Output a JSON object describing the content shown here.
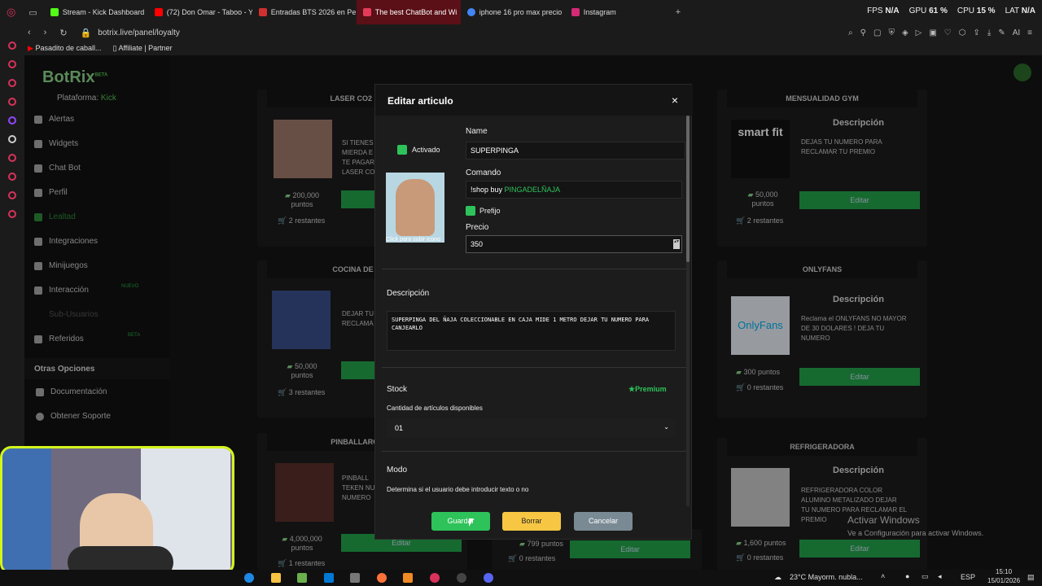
{
  "browser": {
    "tabs": [
      {
        "label": "Stream - Kick Dashboard",
        "color": "#53fc18"
      },
      {
        "label": "(72) Don Omar - Taboo - Y",
        "color": "#ff0000"
      },
      {
        "label": "Entradas BTS 2026 en Pe",
        "color": "#d03030"
      },
      {
        "label": "The best ChatBot and Wi",
        "color": "#e53b5a"
      },
      {
        "label": "iphone 16 pro max precio",
        "color": "#4285f4"
      },
      {
        "label": "Instagram",
        "color": "#d62976"
      }
    ],
    "url": "botrix.live/panel/loyalty",
    "bookmarks": [
      "Pasadito de caball...",
      "Affiliate | Partner"
    ],
    "perf": {
      "fps_label": "FPS",
      "fps": "N/A",
      "gpu_label": "GPU",
      "gpu": "61 %",
      "cpu_label": "CPU",
      "cpu": "15 %",
      "lat_label": "LAT",
      "lat": "N/A"
    },
    "ai_label": "AI"
  },
  "sidebar": {
    "logo": "BotRix",
    "logo_tag": "BETA",
    "platform_label": "Plataforma:",
    "platform": "Kick",
    "items": [
      {
        "label": "Alertas"
      },
      {
        "label": "Widgets"
      },
      {
        "label": "Chat Bot"
      },
      {
        "label": "Perfil"
      },
      {
        "label": "Lealtad"
      },
      {
        "label": "Integraciones"
      },
      {
        "label": "Minijuegos"
      },
      {
        "label": "Interacción",
        "badge": "NUEVO"
      },
      {
        "label": "Sub-Usuarios"
      },
      {
        "label": "Referidos",
        "badge": "BETA"
      }
    ],
    "other_title": "Otras Opciones",
    "other": [
      {
        "label": "Documentación"
      },
      {
        "label": "Obtener Soporte"
      }
    ]
  },
  "cards": {
    "left": [
      {
        "title": "LASER CO2 FRAC",
        "desc": "SI TIENES\nMIERDA E\nTE PAGAR\nLASER CO",
        "points": "200,000",
        "points_label": "puntos",
        "remaining": "2 restantes"
      },
      {
        "title": "COCINA DE CAM",
        "desc": "DEJAR TU\nRECLAMA",
        "points": "50,000",
        "points_label": "puntos",
        "remaining": "3 restantes"
      },
      {
        "title": "PINBALLARCADE",
        "desc": "PINBALL\nTEKEN NU\nNUMERO",
        "points": "4,000,000",
        "points_label": "puntos",
        "remaining": "1 restantes"
      }
    ],
    "right": [
      {
        "title": "MENSUALIDAD GYM",
        "desc_title": "Descripción",
        "desc": "DEJAS TU NUMERO PARA RECLAMAR TU PREMIO",
        "logo_text": "smart fit",
        "points": "50,000",
        "points_label": "puntos",
        "remaining": "2 restantes",
        "button": "Editar"
      },
      {
        "title": "ONLYFANS",
        "desc_title": "Descripción",
        "desc": "Reclama el ONLYFANS NO MAYOR DE 30 DOLARES ! DEJA TU NUMERO",
        "logo_text": "OnlyFans",
        "points": "300 puntos",
        "remaining": "0 restantes",
        "button": "Editar"
      },
      {
        "title": "REFRIGERADORA",
        "desc_title": "Descripción",
        "desc": "REFRIGERADORA COLOR ALUMINO METALIZADO DEJAR TU NUMERO PARA RECLAMAR EL PREMIO",
        "points": "1,600 puntos",
        "remaining": "0 restantes",
        "button": "Editar"
      }
    ],
    "mid_bottom": {
      "points": "799 puntos",
      "remaining": "0 restantes",
      "button": "Editar"
    },
    "left_button": "Editar"
  },
  "modal": {
    "title": "Editar articulo",
    "close": "×",
    "activado_label": "Activado",
    "upload_hint": "Click para subir icono",
    "name_label": "Name",
    "name_value": "SUPERPINGA",
    "command_label": "Comando",
    "command_prefix": "!shop buy ",
    "command_value": "PINGADELÑAJA",
    "prefix_label": "Prefijo",
    "price_label": "Precio",
    "price_value": "350",
    "desc_label": "Descripción",
    "desc_value": "SUPERPINGA DEL ÑAJA COLECCIONABLE EN CAJA MIDE 1 METRO DEJAR TU NUMERO PARA CANJEARLO",
    "stock_label": "Stock",
    "premium": "Premium",
    "stock_hint": "Cantidad de artículos disponibles",
    "stock_value": "01",
    "mode_label": "Modo",
    "mode_hint": "Determina si el usuario debe introducir texto o no",
    "save": "Guardar",
    "delete": "Borrar",
    "cancel": "Cancelar"
  },
  "watermark": {
    "title": "Activar Windows",
    "sub": "Ve a Configuración para activar Windows."
  },
  "taskbar": {
    "weather": "23°C  Mayorm. nubla...",
    "lang": "ESP",
    "time": "15:10",
    "date": "15/01/2026"
  }
}
